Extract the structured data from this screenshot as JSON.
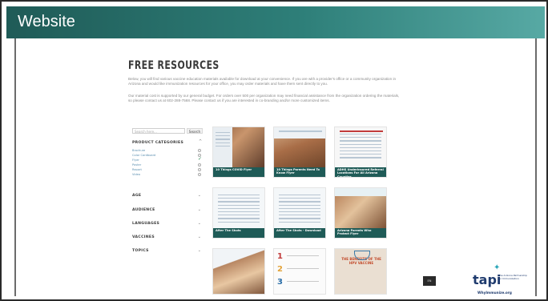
{
  "slide": {
    "title": "Website"
  },
  "page": {
    "heading": "FREE RESOURCES",
    "intro": "Below, you will find various vaccine education materials available for download at your convenience. If you are with a provider's office or a community organization in Arizona and would like immunization resources for your office, you may order materials and have them sent directly to you.",
    "cost_note": "Our material cost is supported by our general budget. For orders over 500 per organization may need financial assistance from the organization ordering the materials, so please contact us at 602-288-7568. Please contact us if you are interested in co-branding and/or more customized items."
  },
  "sidebar": {
    "search_placeholder": "Search here...",
    "search_button": "Search",
    "product_categories_label": "PRODUCT CATEGORIES",
    "categories": [
      {
        "label": "Brochure",
        "checked": false
      },
      {
        "label": "Color Cardboard",
        "checked": false
      },
      {
        "label": "Flyer",
        "checked": true
      },
      {
        "label": "Poster",
        "checked": false
      },
      {
        "label": "Report",
        "checked": false
      },
      {
        "label": "Video",
        "checked": false
      }
    ],
    "filters": [
      "AGE",
      "AUDIENCE",
      "LANGUAGES",
      "VACCINES",
      "TOPICS"
    ]
  },
  "products": [
    {
      "caption": "10 Things COVID Flyer"
    },
    {
      "caption": "10 Things Parents Need To Know Flyer"
    },
    {
      "caption": "ADHS Underinsured Referral Locations For All Arizona Counties"
    },
    {
      "caption": "After The Shots"
    },
    {
      "caption": "After The Shots - Download"
    },
    {
      "caption": "Arizona Parents Who Protect Flyer"
    },
    {
      "caption": ""
    },
    {
      "caption": ""
    },
    {
      "caption": "THE BENEFITS OF THE HPV VACCINE"
    }
  ],
  "footer": {
    "small_button": "EN",
    "logo_text": "tapi",
    "logo_tagline": "The Arizona Partnership for Immunization",
    "logo_url": "WhyImmunize.org"
  },
  "colors": {
    "header_gradient_start": "#1f5b57",
    "header_gradient_end": "#57a9a4",
    "caption_bar": "#1f5b57",
    "link_blue": "#5b8fb0",
    "logo_navy": "#1f3b6e",
    "logo_teal": "#2aa6b8"
  }
}
